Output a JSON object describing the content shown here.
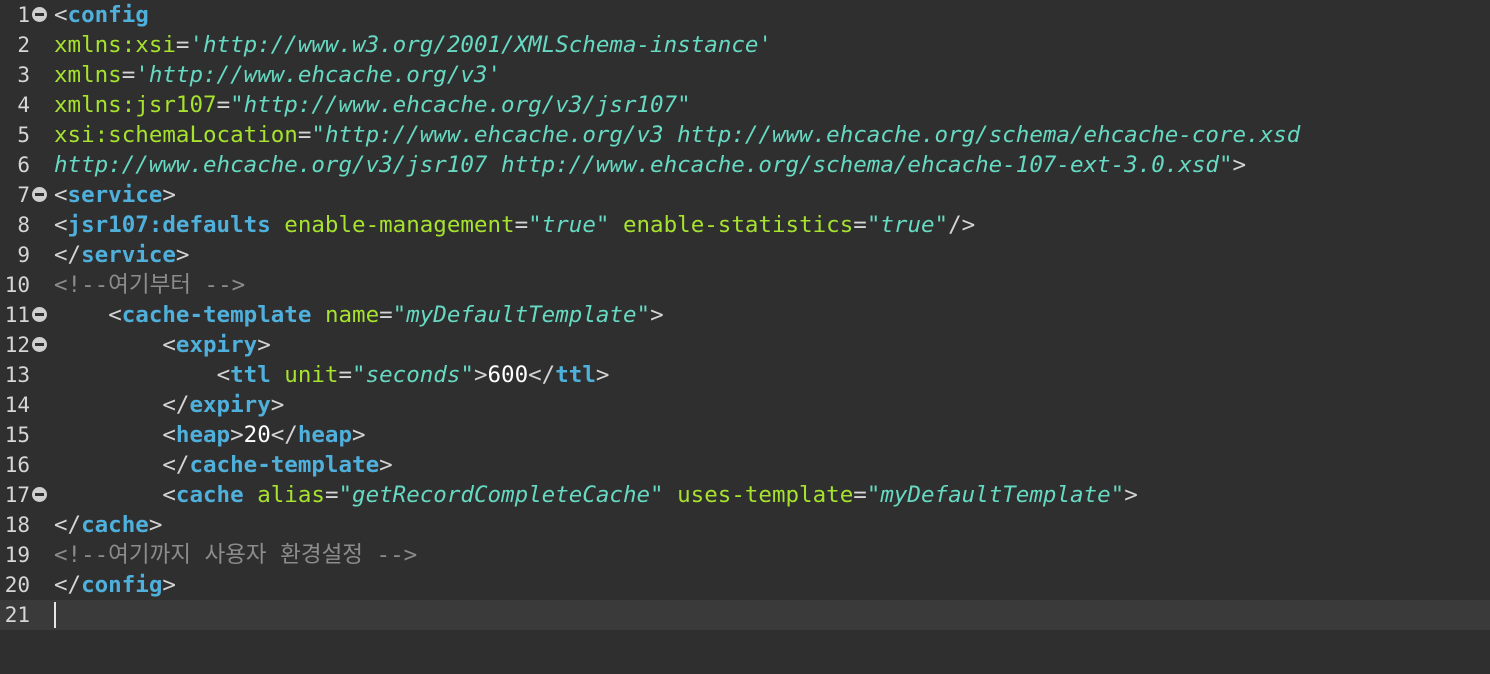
{
  "editor": {
    "language": "xml",
    "current_line": 21,
    "colors": {
      "background": "#2f2f2f",
      "current_line": "#3a3a3a",
      "tag": "#4fb0dc",
      "attribute": "#a6e22e",
      "value": "#66d9c2",
      "comment": "#8c8c8c",
      "text": "#ffffff",
      "punctuation": "#d4d4d4"
    },
    "lines": [
      {
        "n": "1",
        "fold": true,
        "segs": [
          [
            "p",
            "<"
          ],
          [
            "t",
            "config"
          ]
        ]
      },
      {
        "n": "2",
        "fold": false,
        "segs": [
          [
            "a",
            "xmlns:xsi"
          ],
          [
            "p",
            "="
          ],
          [
            "q",
            "'"
          ],
          [
            "v",
            "http://www.w3.org/2001/XMLSchema-instance"
          ],
          [
            "q",
            "'"
          ]
        ]
      },
      {
        "n": "3",
        "fold": false,
        "segs": [
          [
            "a",
            "xmlns"
          ],
          [
            "p",
            "="
          ],
          [
            "q",
            "'"
          ],
          [
            "v",
            "http://www.ehcache.org/v3"
          ],
          [
            "q",
            "'"
          ]
        ]
      },
      {
        "n": "4",
        "fold": false,
        "segs": [
          [
            "a",
            "xmlns:jsr107"
          ],
          [
            "p",
            "="
          ],
          [
            "q",
            "\""
          ],
          [
            "v",
            "http://www.ehcache.org/v3/jsr107"
          ],
          [
            "q",
            "\""
          ]
        ]
      },
      {
        "n": "5",
        "fold": false,
        "segs": [
          [
            "a",
            "xsi:schemaLocation"
          ],
          [
            "p",
            "="
          ],
          [
            "q",
            "\""
          ],
          [
            "v",
            "http://www.ehcache.org/v3 http://www.ehcache.org/schema/ehcache-core.xsd"
          ]
        ]
      },
      {
        "n": "6",
        "fold": false,
        "segs": [
          [
            "v",
            "http://www.ehcache.org/v3/jsr107 http://www.ehcache.org/schema/ehcache-107-ext-3.0.xsd"
          ],
          [
            "q",
            "\""
          ],
          [
            "p",
            ">"
          ]
        ]
      },
      {
        "n": "7",
        "fold": true,
        "segs": [
          [
            "p",
            "<"
          ],
          [
            "t",
            "service"
          ],
          [
            "p",
            ">"
          ]
        ]
      },
      {
        "n": "8",
        "fold": false,
        "segs": [
          [
            "p",
            "<"
          ],
          [
            "t",
            "jsr107:defaults"
          ],
          [
            "x",
            " "
          ],
          [
            "a",
            "enable-management"
          ],
          [
            "p",
            "="
          ],
          [
            "q",
            "\""
          ],
          [
            "v",
            "true"
          ],
          [
            "q",
            "\""
          ],
          [
            "x",
            " "
          ],
          [
            "a",
            "enable-statistics"
          ],
          [
            "p",
            "="
          ],
          [
            "q",
            "\""
          ],
          [
            "v",
            "true"
          ],
          [
            "q",
            "\""
          ],
          [
            "p",
            "/>"
          ]
        ]
      },
      {
        "n": "9",
        "fold": false,
        "segs": [
          [
            "p",
            "</"
          ],
          [
            "t",
            "service"
          ],
          [
            "p",
            ">"
          ]
        ]
      },
      {
        "n": "10",
        "fold": false,
        "segs": [
          [
            "c",
            "<!--여기부터 -->"
          ]
        ]
      },
      {
        "n": "11",
        "fold": true,
        "segs": [
          [
            "x",
            "    "
          ],
          [
            "p",
            "<"
          ],
          [
            "t",
            "cache-template"
          ],
          [
            "x",
            " "
          ],
          [
            "a",
            "name"
          ],
          [
            "p",
            "="
          ],
          [
            "q",
            "\""
          ],
          [
            "v",
            "myDefaultTemplate"
          ],
          [
            "q",
            "\""
          ],
          [
            "p",
            ">"
          ]
        ]
      },
      {
        "n": "12",
        "fold": true,
        "segs": [
          [
            "x",
            "        "
          ],
          [
            "p",
            "<"
          ],
          [
            "t",
            "expiry"
          ],
          [
            "p",
            ">"
          ]
        ]
      },
      {
        "n": "13",
        "fold": false,
        "segs": [
          [
            "x",
            "            "
          ],
          [
            "p",
            "<"
          ],
          [
            "t",
            "ttl"
          ],
          [
            "x",
            " "
          ],
          [
            "a",
            "unit"
          ],
          [
            "p",
            "="
          ],
          [
            "q",
            "\""
          ],
          [
            "v",
            "seconds"
          ],
          [
            "q",
            "\""
          ],
          [
            "p",
            ">"
          ],
          [
            "x",
            "600"
          ],
          [
            "p",
            "</"
          ],
          [
            "t",
            "ttl"
          ],
          [
            "p",
            ">"
          ]
        ]
      },
      {
        "n": "14",
        "fold": false,
        "segs": [
          [
            "x",
            "        "
          ],
          [
            "p",
            "</"
          ],
          [
            "t",
            "expiry"
          ],
          [
            "p",
            ">"
          ]
        ]
      },
      {
        "n": "15",
        "fold": false,
        "segs": [
          [
            "x",
            "        "
          ],
          [
            "p",
            "<"
          ],
          [
            "t",
            "heap"
          ],
          [
            "p",
            ">"
          ],
          [
            "x",
            "20"
          ],
          [
            "p",
            "</"
          ],
          [
            "t",
            "heap"
          ],
          [
            "p",
            ">"
          ]
        ]
      },
      {
        "n": "16",
        "fold": false,
        "segs": [
          [
            "x",
            "        "
          ],
          [
            "p",
            "</"
          ],
          [
            "t",
            "cache-template"
          ],
          [
            "p",
            ">"
          ]
        ]
      },
      {
        "n": "17",
        "fold": true,
        "segs": [
          [
            "x",
            "        "
          ],
          [
            "p",
            "<"
          ],
          [
            "t",
            "cache"
          ],
          [
            "x",
            " "
          ],
          [
            "a",
            "alias"
          ],
          [
            "p",
            "="
          ],
          [
            "q",
            "\""
          ],
          [
            "v",
            "getRecordCompleteCache"
          ],
          [
            "q",
            "\""
          ],
          [
            "x",
            " "
          ],
          [
            "a",
            "uses-template"
          ],
          [
            "p",
            "="
          ],
          [
            "q",
            "\""
          ],
          [
            "v",
            "myDefaultTemplate"
          ],
          [
            "q",
            "\""
          ],
          [
            "p",
            ">"
          ]
        ]
      },
      {
        "n": "18",
        "fold": false,
        "segs": [
          [
            "p",
            "</"
          ],
          [
            "t",
            "cache"
          ],
          [
            "p",
            ">"
          ]
        ]
      },
      {
        "n": "19",
        "fold": false,
        "segs": [
          [
            "c",
            "<!--여기까지 사용자 환경설정 -->"
          ]
        ]
      },
      {
        "n": "20",
        "fold": false,
        "segs": [
          [
            "p",
            "</"
          ],
          [
            "t",
            "config"
          ],
          [
            "p",
            ">"
          ]
        ]
      },
      {
        "n": "21",
        "fold": false,
        "segs": []
      }
    ]
  }
}
